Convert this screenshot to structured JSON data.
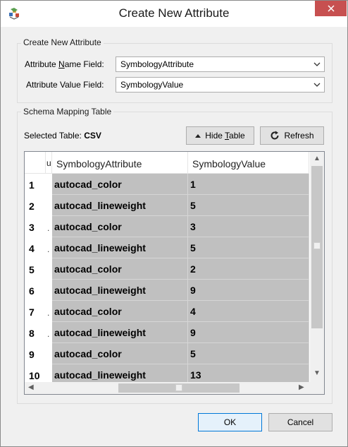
{
  "window": {
    "title": "Create New Attribute",
    "close_icon": "close-icon"
  },
  "attr_group": {
    "label": "Create New Attribute",
    "name_label_pre": "Attribute ",
    "name_label_u": "N",
    "name_label_post": "ame Field:",
    "name_value": "SymbologyAttribute",
    "value_label": "Attribute Value Field:",
    "value_value": "SymbologyValue"
  },
  "schema_group": {
    "label": "Schema Mapping Table",
    "selected_label": "Selected Table:",
    "selected_value": "CSV",
    "hide_button_pre": "Hide ",
    "hide_button_u": "T",
    "hide_button_post": "able",
    "refresh_button": "Refresh"
  },
  "table": {
    "hidden_col_header": "u",
    "columns": [
      "SymbologyAttribute",
      "SymbologyValue"
    ],
    "rows": [
      {
        "num": "1",
        "attr": "autocad_color",
        "value": "1",
        "stub": ""
      },
      {
        "num": "2",
        "attr": "autocad_lineweight",
        "value": "5",
        "stub": ""
      },
      {
        "num": "3",
        "attr": "autocad_color",
        "value": "3",
        "stub": "."
      },
      {
        "num": "4",
        "attr": "autocad_lineweight",
        "value": "5",
        "stub": "."
      },
      {
        "num": "5",
        "attr": "autocad_color",
        "value": "2",
        "stub": ""
      },
      {
        "num": "6",
        "attr": "autocad_lineweight",
        "value": "9",
        "stub": ""
      },
      {
        "num": "7",
        "attr": "autocad_color",
        "value": "4",
        "stub": "."
      },
      {
        "num": "8",
        "attr": "autocad_lineweight",
        "value": "9",
        "stub": "."
      },
      {
        "num": "9",
        "attr": "autocad_color",
        "value": "5",
        "stub": ""
      },
      {
        "num": "10",
        "attr": "autocad_lineweight",
        "value": "13",
        "stub": ""
      }
    ]
  },
  "footer": {
    "ok_label": "OK",
    "cancel_label": "Cancel"
  },
  "colors": {
    "close": "#c75050",
    "cell_bg": "#c0c0c0",
    "ok_border": "#0078d7"
  }
}
